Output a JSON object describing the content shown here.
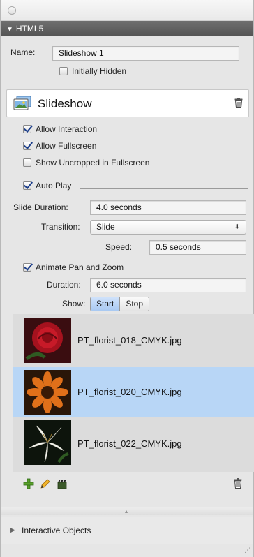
{
  "section": {
    "title": "HTML5"
  },
  "name_field": {
    "label": "Name:",
    "value": "Slideshow 1"
  },
  "initially_hidden": {
    "label": "Initially Hidden",
    "checked": false
  },
  "slideshow": {
    "title": "Slideshow"
  },
  "options": {
    "allow_interaction": {
      "label": "Allow Interaction",
      "checked": true
    },
    "allow_fullscreen": {
      "label": "Allow Fullscreen",
      "checked": true
    },
    "show_uncropped": {
      "label": "Show Uncropped in Fullscreen",
      "checked": false
    },
    "auto_play": {
      "label": "Auto Play",
      "checked": true
    }
  },
  "slide_duration": {
    "label": "Slide Duration:",
    "value": "4.0 seconds"
  },
  "transition": {
    "label": "Transition:",
    "value": "Slide"
  },
  "speed": {
    "label": "Speed:",
    "value": "0.5 seconds"
  },
  "animate": {
    "label": "Animate Pan and Zoom",
    "checked": true
  },
  "duration": {
    "label": "Duration:",
    "value": "6.0 seconds"
  },
  "show": {
    "label": "Show:",
    "options": [
      "Start",
      "Stop"
    ],
    "selected": "Start"
  },
  "images": [
    {
      "file": "PT_florist_018_CMYK.jpg",
      "selected": false
    },
    {
      "file": "PT_florist_020_CMYK.jpg",
      "selected": true
    },
    {
      "file": "PT_florist_022_CMYK.jpg",
      "selected": false
    }
  ],
  "interactive_objects": {
    "label": "Interactive Objects"
  },
  "colors": {
    "accent": "#b8d6f6",
    "header": "#5f5f5f"
  }
}
